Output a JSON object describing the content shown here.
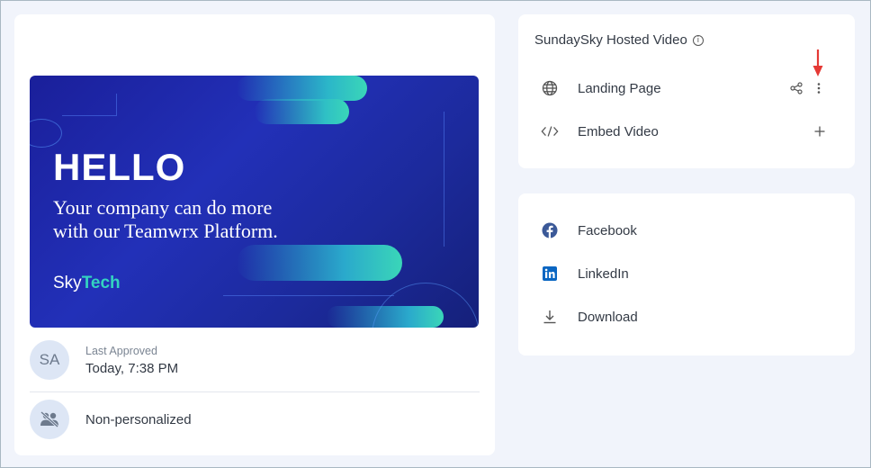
{
  "thumbnail": {
    "headline": "HELLO",
    "tagline_line1": "Your company can do more",
    "tagline_line2": "with our Teamwrx Platform.",
    "logo_sky": "Sky",
    "logo_tech": "Tech"
  },
  "approval": {
    "avatar_initials": "SA",
    "label": "Last Approved",
    "value": "Today, 7:38 PM"
  },
  "personalization": {
    "label": "Non-personalized",
    "icon": "no-users-icon"
  },
  "hosted": {
    "title": "SundaySky Hosted Video",
    "info_icon": "ⓘ",
    "items": [
      {
        "label": "Landing Page",
        "icon": "globe-icon"
      },
      {
        "label": "Embed Video",
        "icon": "code-icon"
      }
    ]
  },
  "share": {
    "items": [
      {
        "label": "Facebook",
        "icon": "facebook-icon"
      },
      {
        "label": "LinkedIn",
        "icon": "linkedin-icon"
      },
      {
        "label": "Download",
        "icon": "download-icon"
      }
    ]
  },
  "colors": {
    "page_bg": "#f1f4fb",
    "card_bg": "#ffffff",
    "annotation_arrow": "#e53935",
    "thumbnail_bg": "#1f2bb0",
    "accent_teal": "#34d3c0"
  }
}
